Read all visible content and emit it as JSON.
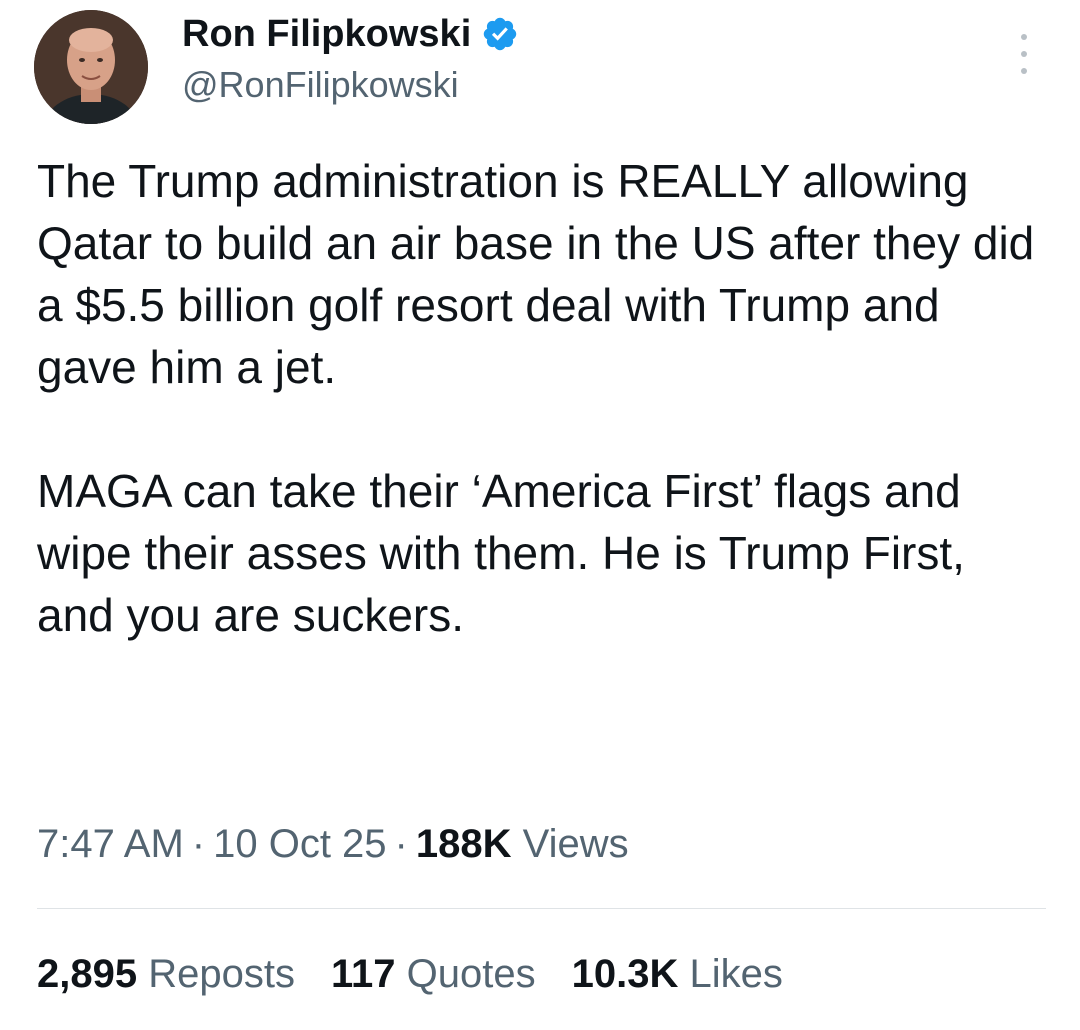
{
  "author": {
    "display_name": "Ron Filipkowski",
    "handle": "@RonFilipkowski",
    "verified_color": "#1d9bf0"
  },
  "tweet": {
    "paragraphs": [
      "The Trump administration is REALLY allowing Qatar to build an air base in the US after they did a $5.5 billion golf resort deal with Trump and gave him a jet.",
      "MAGA can take their ‘America First’ flags and wipe their asses with them. He is Trump First, and you are suckers."
    ]
  },
  "meta": {
    "time": "7:47 AM",
    "date": "10 Oct 25",
    "views_count": "188K",
    "views_label": "Views",
    "separator": "·"
  },
  "stats": {
    "reposts": {
      "count": "2,895",
      "label": "Reposts"
    },
    "quotes": {
      "count": "117",
      "label": "Quotes"
    },
    "likes": {
      "count": "10.3K",
      "label": "Likes"
    }
  },
  "icons": {
    "verified": "verified-badge-icon",
    "more": "more-options-icon"
  }
}
